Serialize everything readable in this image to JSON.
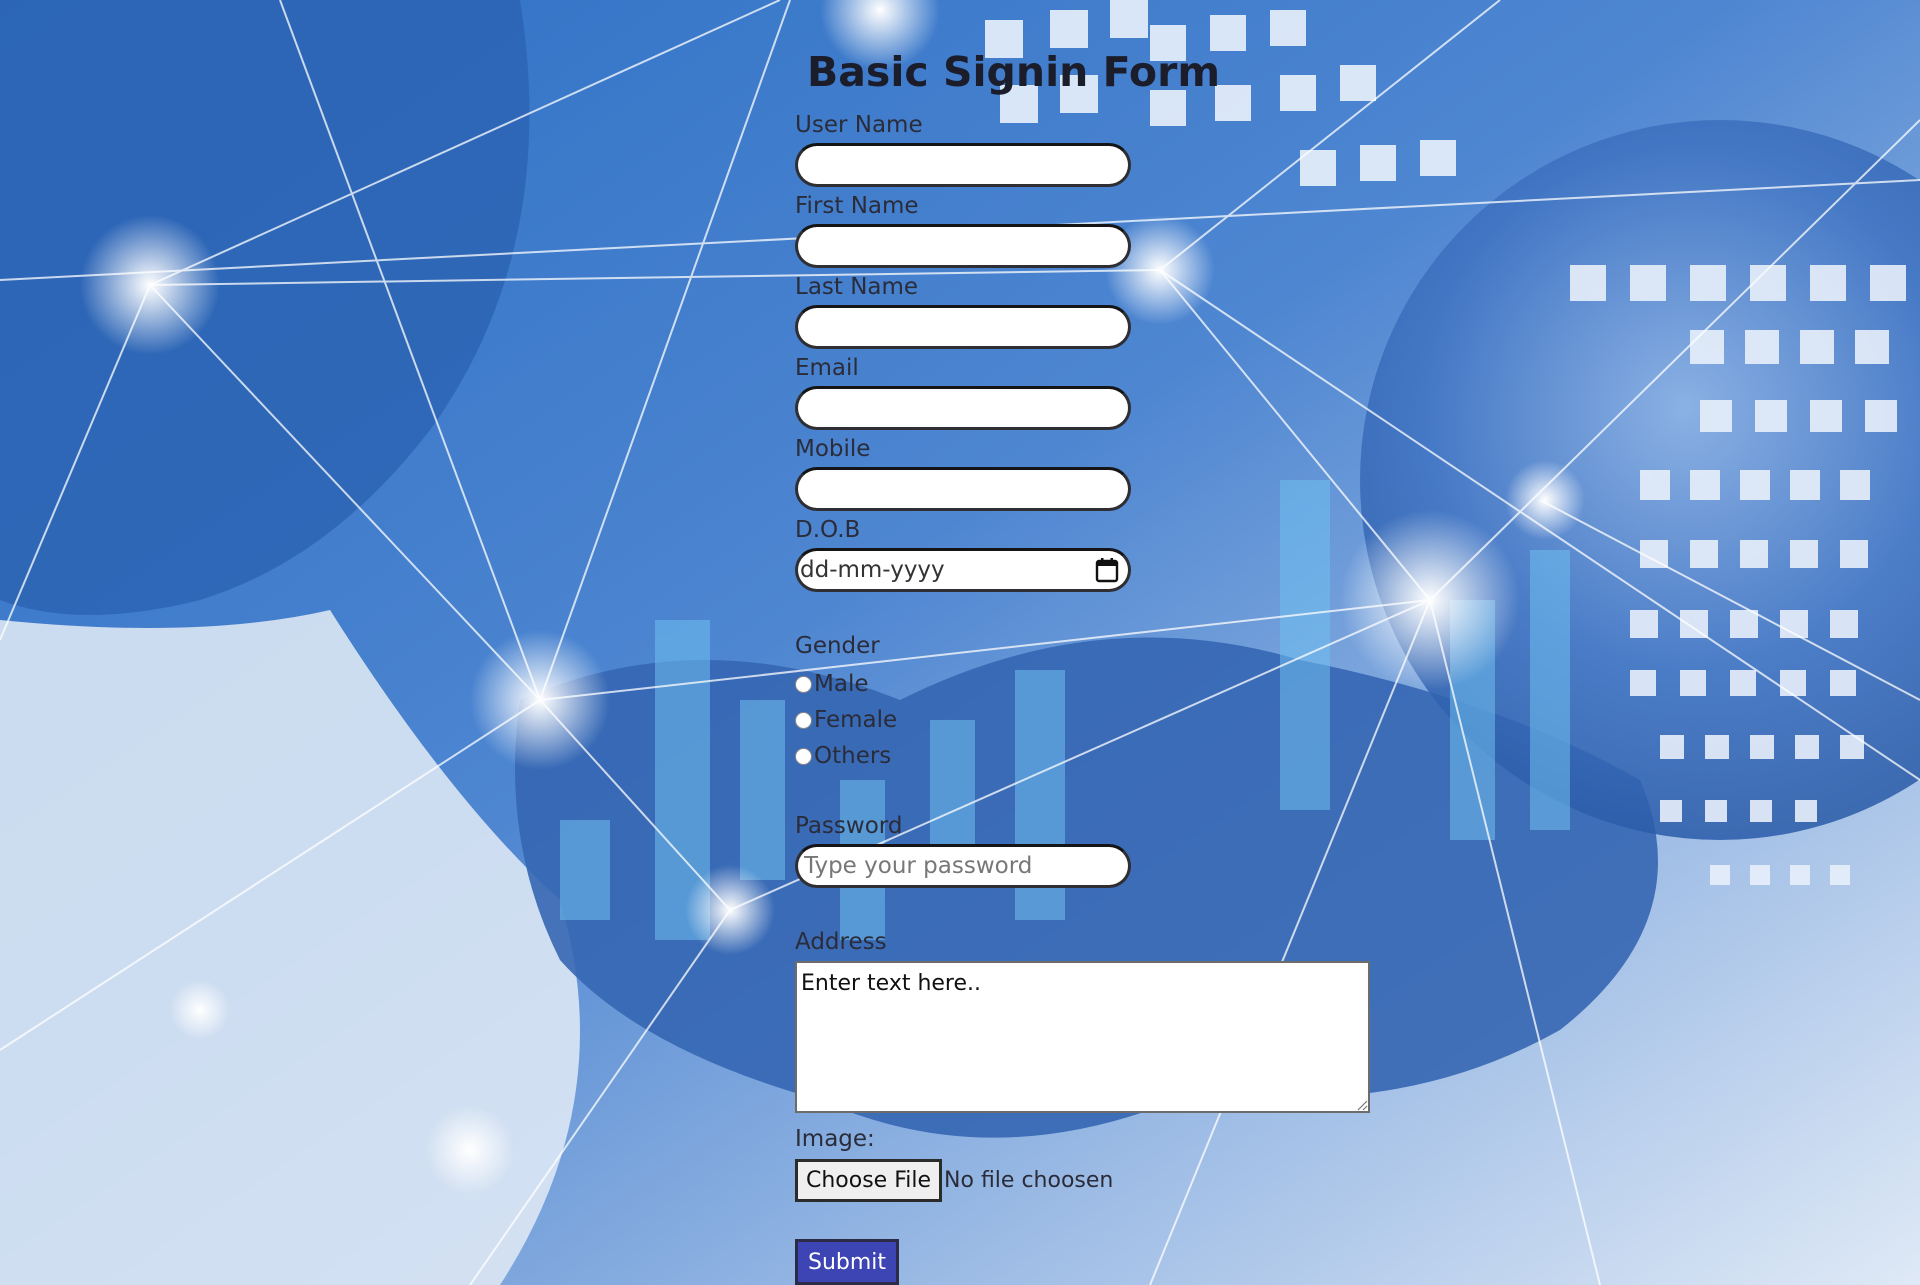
{
  "form": {
    "title": "Basic Signin Form",
    "fields": {
      "username": {
        "label": "User Name",
        "value": ""
      },
      "first_name": {
        "label": "First Name",
        "value": ""
      },
      "last_name": {
        "label": "Last Name",
        "value": ""
      },
      "email": {
        "label": "Email",
        "value": ""
      },
      "mobile": {
        "label": "Mobile",
        "value": ""
      },
      "dob": {
        "label": "D.O.B",
        "placeholder": "dd-mm-yyyy"
      },
      "gender": {
        "label": "Gender",
        "options": [
          "Male",
          "Female",
          "Others"
        ]
      },
      "password": {
        "label": "Password",
        "placeholder": "Type your password"
      },
      "address": {
        "label": "Address",
        "value": "Enter text here.."
      },
      "image": {
        "label": "Image:",
        "button_label": "Choose File",
        "status": "No file choosen"
      }
    },
    "submit_label": "Submit"
  },
  "colors": {
    "submit_bg": "#3d44b4",
    "input_border": "#2e2e33",
    "title_text": "#1b1d2b"
  },
  "icons": {
    "dob": "calendar-icon"
  }
}
